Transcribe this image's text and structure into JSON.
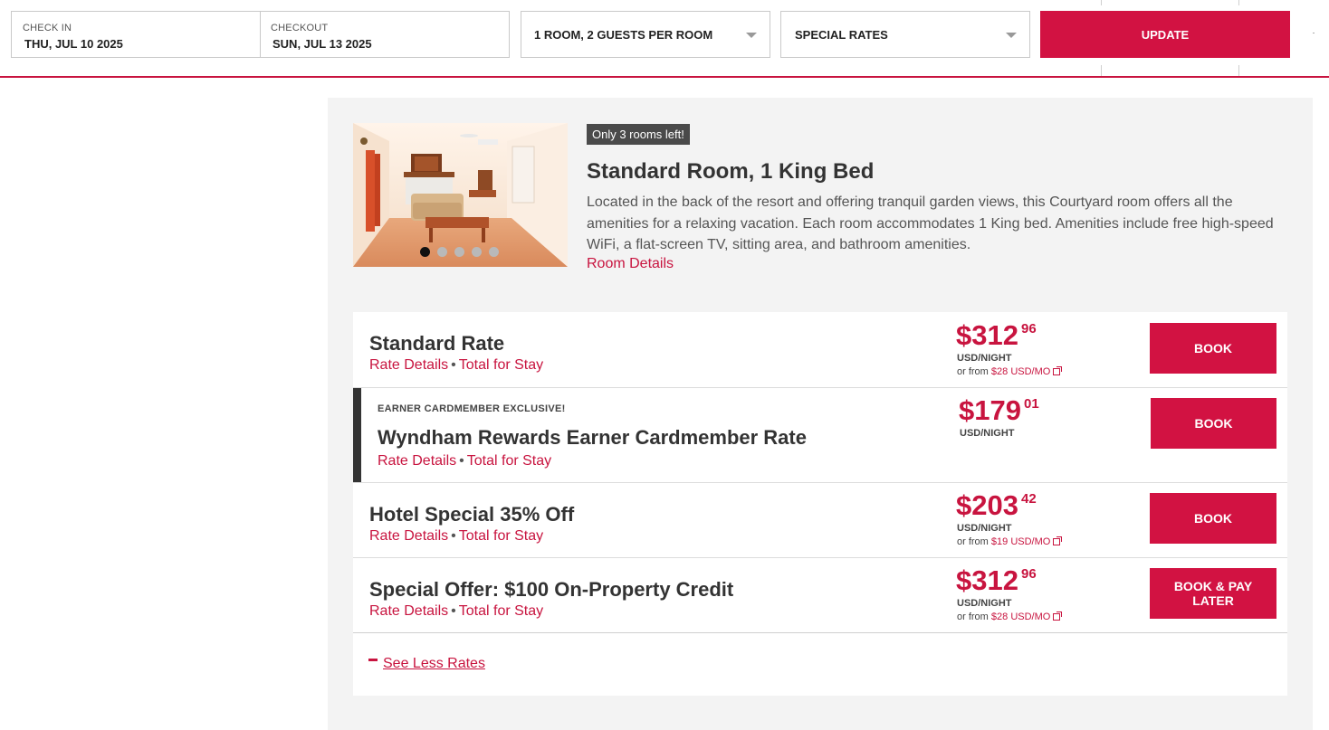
{
  "search": {
    "checkin_label": "CHECK IN",
    "checkin_value": "THU, JUL 10 2025",
    "checkout_label": "CHECKOUT",
    "checkout_value": "SUN, JUL 13 2025",
    "rooms_guests": "1 ROOM, 2 GUESTS PER ROOM",
    "rate_type": "SPECIAL RATES",
    "update_label": "UPDATE"
  },
  "room": {
    "availability": "Only 3 rooms left!",
    "title": "Standard Room, 1 King Bed",
    "description": "Located in the back of the resort and offering tranquil garden views, this Courtyard room offers all the amenities for a relaxing vacation. Each room accommodates 1 King bed. Amenities include free high-speed WiFi, a flat-screen TV, sitting area, and bathroom amenities.",
    "details_link": "Room Details",
    "photo_count": 5,
    "active_photo": 1
  },
  "rates": [
    {
      "name": "Standard Rate",
      "rate_details": "Rate Details",
      "separator": "•",
      "total": "Total for Stay",
      "price_main": "$312",
      "price_cents": "96",
      "unit": "USD/NIGHT",
      "from_prefix": "or from",
      "from_amount": "$28 USD/MO",
      "button": "BOOK"
    },
    {
      "eyebrow": "EARNER CARDMEMBER EXCLUSIVE!",
      "name": "Wyndham Rewards Earner Cardmember Rate",
      "rate_details": "Rate Details",
      "separator": "•",
      "total": "Total for Stay",
      "price_main": "$179",
      "price_cents": "01",
      "unit": "USD/NIGHT",
      "button": "BOOK"
    },
    {
      "name": "Hotel Special 35% Off",
      "rate_details": "Rate Details",
      "separator": "•",
      "total": "Total for Stay",
      "price_main": "$203",
      "price_cents": "42",
      "unit": "USD/NIGHT",
      "from_prefix": "or from",
      "from_amount": "$19 USD/MO",
      "button": "BOOK"
    },
    {
      "name": "Special Offer: $100 On-Property Credit",
      "rate_details": "Rate Details",
      "separator": "•",
      "total": "Total for Stay",
      "price_main": "$312",
      "price_cents": "96",
      "unit": "USD/NIGHT",
      "from_prefix": "or from",
      "from_amount": "$28 USD/MO",
      "button_line1": "BOOK & PAY",
      "button_line2": "LATER"
    }
  ],
  "see_less": "See Less Rates",
  "colors": {
    "brand": "#d21242",
    "link": "#c8143f",
    "panel_bg": "#f3f3f3",
    "badge_bg": "#4a4a4a"
  },
  "icons": [
    "caret-down-icon",
    "external-link-icon",
    "minus-icon"
  ]
}
